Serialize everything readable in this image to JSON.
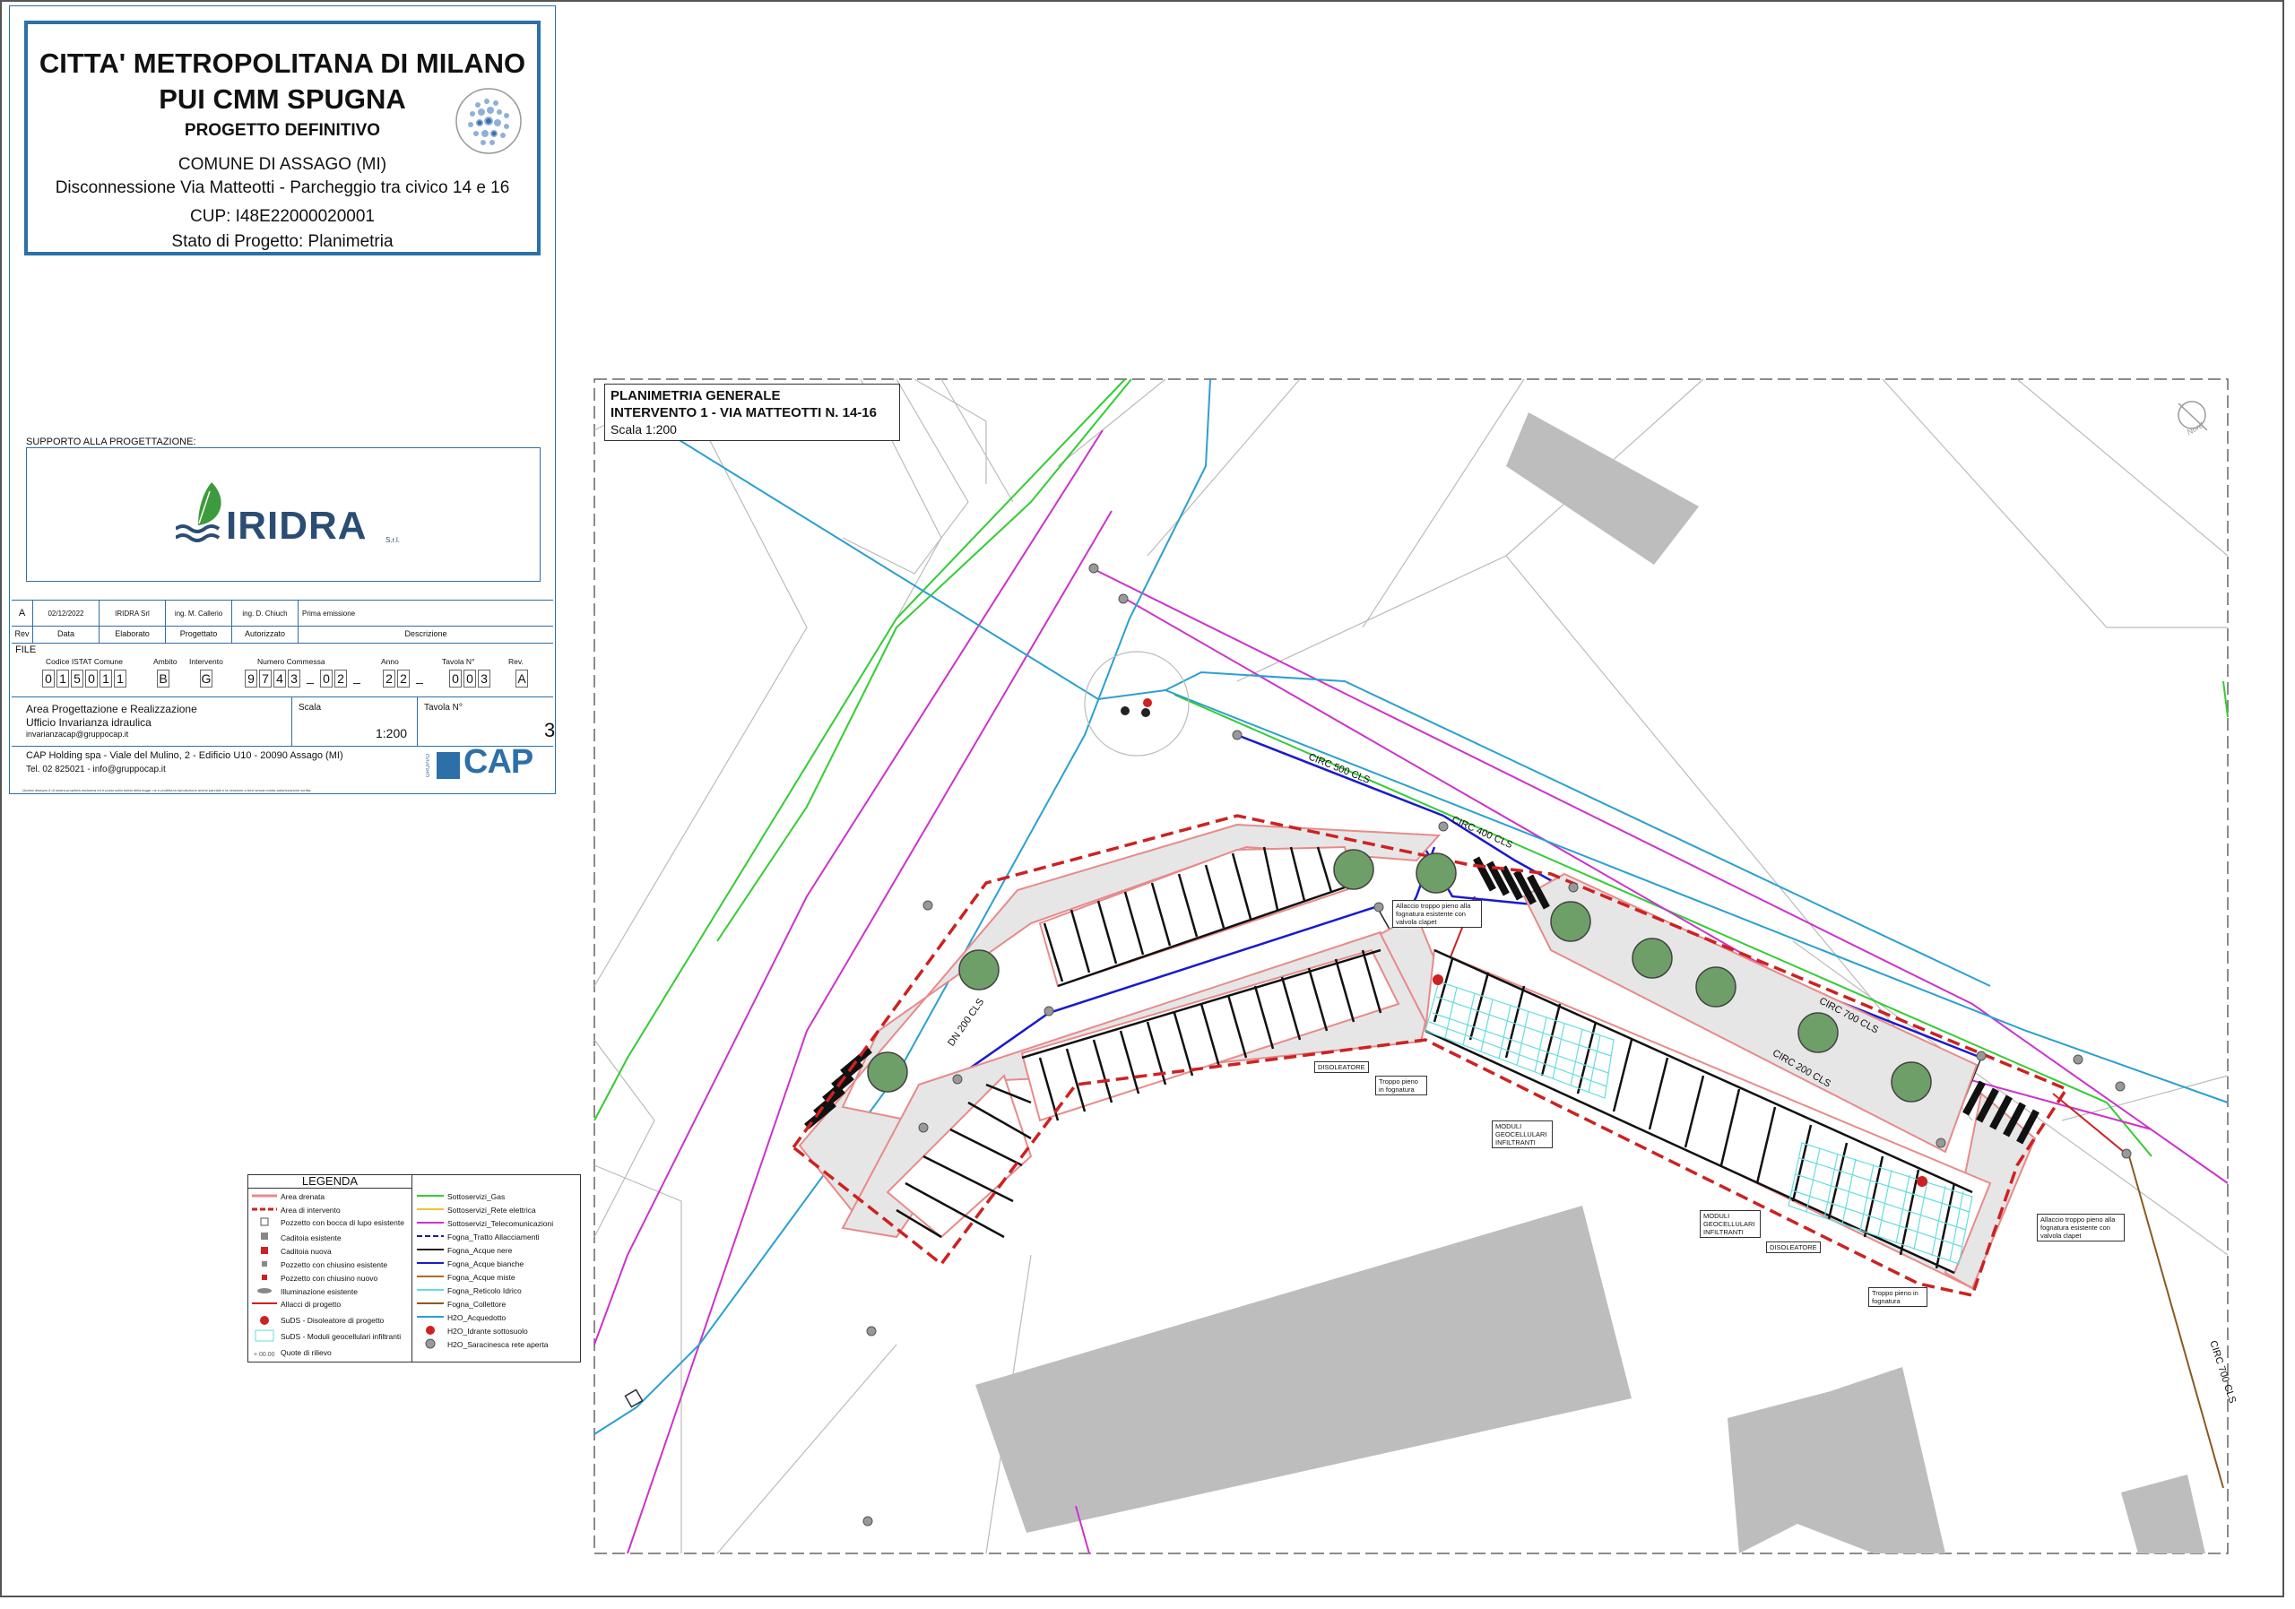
{
  "title_block": {
    "line1": "CITTA' METROPOLITANA DI MILANO",
    "line2": "PUI CMM SPUGNA",
    "line3": "PROGETTO DEFINITIVO",
    "line4": "COMUNE DI ASSAGO (MI)",
    "line5": "Disconnessione Via Matteotti - Parcheggio tra civico 14 e 16",
    "line6": "CUP: I48E22000020001",
    "line7": "Stato di Progetto: Planimetria"
  },
  "support": {
    "label": "SUPPORTO ALLA PROGETTAZIONE:",
    "company": "IRIDRA",
    "suffix": "S.r.l."
  },
  "revision": {
    "row": [
      "A",
      "02/12/2022",
      "IRIDRA Srl",
      "ing. M. Callerio",
      "ing. D. Chiuch",
      "Prima emissione"
    ],
    "headers": [
      "Rev",
      "Data",
      "Elaborato",
      "Progettato",
      "Autorizzato",
      "Descrizione"
    ]
  },
  "file": {
    "label": "FILE",
    "headers": [
      "Codice ISTAT Comune",
      "Ambito",
      "Intervento",
      "Numero Commessa",
      "Anno",
      "Tavola N°",
      "Rev."
    ],
    "istat": [
      "0",
      "1",
      "5",
      "0",
      "1",
      "1"
    ],
    "ambito": "B",
    "intervento": "G",
    "commessa_a": [
      "9",
      "7",
      "4",
      "3"
    ],
    "commessa_b": [
      "0",
      "2"
    ],
    "anno": [
      "2",
      "2"
    ],
    "tavola": [
      "0",
      "0",
      "3"
    ],
    "rev": "A",
    "sep": "_"
  },
  "area": {
    "l1": "Area Progettazione e Realizzazione",
    "l2": "Ufficio Invarianza idraulica",
    "l3": "invarianzacap@gruppocap.it",
    "scala_label": "Scala",
    "scala_value": "1:200",
    "tavola_label": "Tavola N°",
    "tavola_value": "3"
  },
  "cap": {
    "address": "CAP Holding spa - Viale del Mulino, 2 - Edificio U10 - 20090 Assago (MI)",
    "contact": "Tel. 02 825021 - info@gruppocap.it",
    "word": "CAP",
    "gruppo": "GRUPPO"
  },
  "footnote": "Questo disegno è di nostra proprietà esclusiva ed è posto sotto tutela della legge, ne è proibita la riproduzione anche parziale e la cessione a terzi senza nostra autorizzazione scritta.",
  "plan": {
    "title1": "PLANIMETRIA GENERALE",
    "title2": "INTERVENTO 1 - VIA MATTEOTTI N. 14-16",
    "scale": "Scala 1:200",
    "north": "Nord",
    "labels": {
      "circ500": "CIRC 500 CLS",
      "circ400": "CIRC 400 CLS",
      "circ700": "CIRC 700 CLS",
      "circ200": "CIRC 200 CLS",
      "circ700b": "CIRC 700 CLS",
      "dn": "DN 200 CLS"
    },
    "annotations": {
      "allaccio1": "Allaccio troppo pieno alla fognatura esistente con valvola clapet",
      "disoleatore1": "DISOLEATORE",
      "troppo1": "Troppo pieno in fognatura",
      "moduli1": "MODULI GEOCELLULARI INFILTRANTI",
      "moduli2": "MODULI GEOCELLULARI INFILTRANTI",
      "disoleatore2": "DISOLEATORE",
      "allaccio2": "Allaccio troppo pieno alla fognatura esistente con valvola clapet",
      "troppo2": "Troppo pieno in fognatura"
    }
  },
  "legend": {
    "title": "LEGENDA",
    "left": [
      "Area drenata",
      "Area di intervento",
      "Pozzetto con bocca di lupo esistente",
      "Caditoia esistente",
      "Caditoia nuova",
      "Pozzetto con chiusino esistente",
      "Pozzetto con chiusino nuovo",
      "Illuminazione esistente",
      "Allacci di progetto",
      "SuDS - Disoleatore di progetto",
      "SuDS - Moduli geocellulari infiltranti",
      "Quote di rilievo"
    ],
    "right": [
      "Sottoservizi_Gas",
      "Sottoservizi_Rete elettrica",
      "Sottoservizi_Telecomunicazioni",
      "Fogna_Tratto Allacciamenti",
      "Fogna_Acque nere",
      "Fogna_Acque bianche",
      "Fogna_Acque miste",
      "Fogna_Reticolo Idrico",
      "Fogna_Collettore",
      "H2O_Acquedotto",
      "H2O_Idrante sottosuolo",
      "H2O_Saracinesca rete aperta"
    ],
    "quote_sample": "+ 00.00",
    "colors": {
      "gas": "#f2c230",
      "elettrica": "#33cc33",
      "telecom": "#cc33cc",
      "allacci": "#1a1aa0",
      "nere": "#222222",
      "bianche": "#1a1acc",
      "miste": "#b06a20",
      "reticolo": "#66dddd",
      "collettore": "#8a5a22",
      "acquedotto": "#2aa0d0"
    }
  }
}
